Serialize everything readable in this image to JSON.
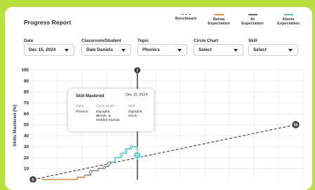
{
  "header": {
    "title": "Progress Report"
  },
  "legend": [
    {
      "label": "Benchmark",
      "color": "#666666",
      "style": "dashed"
    },
    {
      "label": "Below\nExpectation",
      "color": "#f08a24",
      "style": "solid"
    },
    {
      "label": "At\nExpectation",
      "color": "#666666",
      "style": "solid"
    },
    {
      "label": "Above\nExpectation",
      "color": "#4fc9c9",
      "style": "solid"
    }
  ],
  "filters": {
    "date": {
      "label": "Date",
      "value": "Dec 15, 2024"
    },
    "classroom": {
      "label": "Classroom/Student",
      "value": "Dale Daniels"
    },
    "topic": {
      "label": "Topic",
      "value": "Phonics"
    },
    "circle_chart": {
      "label": "Circle Chart",
      "value": "Select"
    },
    "skill": {
      "label": "Skill",
      "value": "Select"
    }
  },
  "tooltip": {
    "title": "Skill Mastered",
    "date": "Dec 15, 2024",
    "topic_label": "Topic",
    "topic_value": "Phonics",
    "circle_label": "Circle Chart",
    "circle_value": "Digraphs,\nBlends, &\nWelded Sounds",
    "skill_label": "Skill",
    "skill_value": "Digraphs:\nch/ch/"
  },
  "chart_data": {
    "type": "line",
    "ylabel": "Skills Mastered (%)",
    "yticks": [
      10,
      20,
      30,
      40,
      50,
      60,
      70,
      80,
      90,
      100
    ],
    "ylim": [
      0,
      100
    ],
    "grid": true,
    "benchmark": {
      "start": 0,
      "end": 50,
      "start_label": "0",
      "end_label": "50"
    },
    "current_marker": {
      "x": 8.5,
      "value": 22,
      "label": "22"
    },
    "progress_segments": [
      {
        "color": "#f08a24",
        "points": [
          [
            0.7,
            0
          ],
          [
            3.6,
            0
          ],
          [
            3.6,
            2
          ],
          [
            4.2,
            2
          ],
          [
            4.2,
            4
          ]
        ]
      },
      {
        "color": "#888888",
        "points": [
          [
            4.2,
            4
          ],
          [
            4.7,
            4
          ],
          [
            4.7,
            8
          ],
          [
            5.3,
            8
          ],
          [
            5.3,
            10
          ],
          [
            5.8,
            10
          ],
          [
            5.8,
            12
          ],
          [
            6.2,
            12
          ]
        ]
      },
      {
        "color": "#4fc9c9",
        "points": [
          [
            6.2,
            12
          ],
          [
            6.2,
            16
          ],
          [
            6.7,
            16
          ],
          [
            6.7,
            20
          ],
          [
            7.2,
            20
          ],
          [
            7.2,
            24
          ],
          [
            7.6,
            24
          ],
          [
            7.6,
            28
          ],
          [
            8.0,
            28
          ],
          [
            8.0,
            30
          ],
          [
            8.5,
            30
          ],
          [
            8.5,
            22
          ]
        ]
      }
    ],
    "dots": [
      {
        "x": 4.7,
        "y": 7,
        "color": "#888888"
      },
      {
        "x": 5.8,
        "y": 11,
        "color": "#888888"
      },
      {
        "x": 6.2,
        "y": 15,
        "color": "#888888"
      },
      {
        "x": 7.2,
        "y": 23,
        "color": "#4fc9c9"
      },
      {
        "x": 7.6,
        "y": 27,
        "color": "#4fc9c9"
      },
      {
        "x": 8.0,
        "y": 30,
        "color": "#4fc9c9"
      }
    ],
    "xlim": [
      0,
      22
    ]
  }
}
